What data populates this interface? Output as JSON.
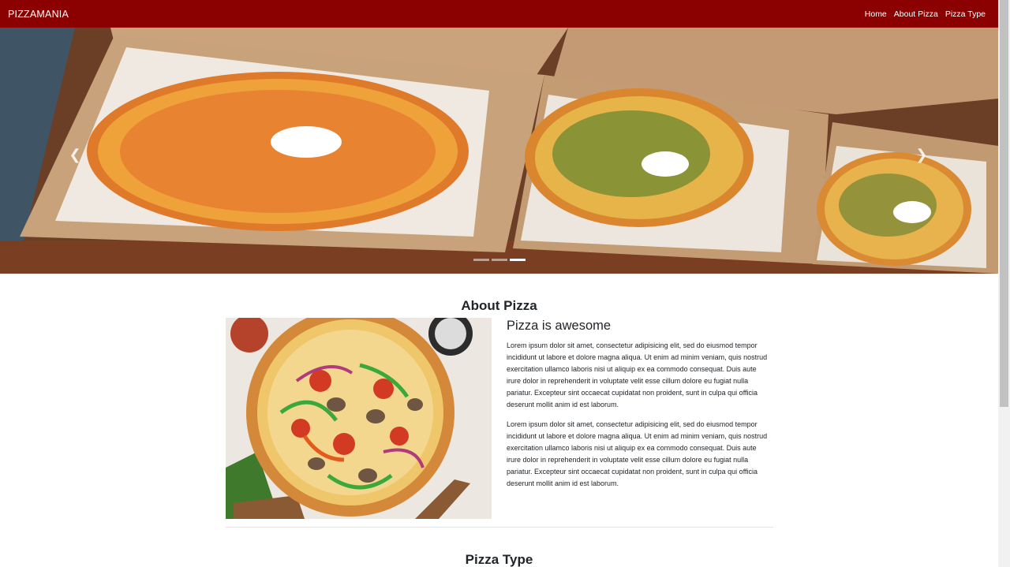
{
  "theme": {
    "brand_color": "#8b0000"
  },
  "navbar": {
    "brand": "PIZZAMANIA",
    "links": [
      "Home",
      "About Pizza",
      "Pizza Type"
    ]
  },
  "carousel": {
    "prev_icon": "chevron-left-icon",
    "next_icon": "chevron-right-icon",
    "slide_count": 3,
    "active_slide": 3
  },
  "about": {
    "title": "About Pizza",
    "heading": "Pizza is awesome",
    "paragraphs": [
      "Lorem ipsum dolor sit amet, consectetur adipisicing elit, sed do eiusmod tempor incididunt ut labore et dolore magna aliqua. Ut enim ad minim veniam, quis nostrud exercitation ullamco laboris nisi ut aliquip ex ea commodo consequat. Duis aute irure dolor in reprehenderit in voluptate velit esse cillum dolore eu fugiat nulla pariatur. Excepteur sint occaecat cupidatat non proident, sunt in culpa qui officia deserunt mollit anim id est laborum.",
      "Lorem ipsum dolor sit amet, consectetur adipisicing elit, sed do eiusmod tempor incididunt ut labore et dolore magna aliqua. Ut enim ad minim veniam, quis nostrud exercitation ullamco laboris nisi ut aliquip ex ea commodo consequat. Duis aute irure dolor in reprehenderit in voluptate velit esse cillum dolore eu fugiat nulla pariatur. Excepteur sint occaecat cupidatat non proident, sunt in culpa qui officia deserunt mollit anim id est laborum."
    ]
  },
  "pizza_type": {
    "title": "Pizza Type"
  }
}
